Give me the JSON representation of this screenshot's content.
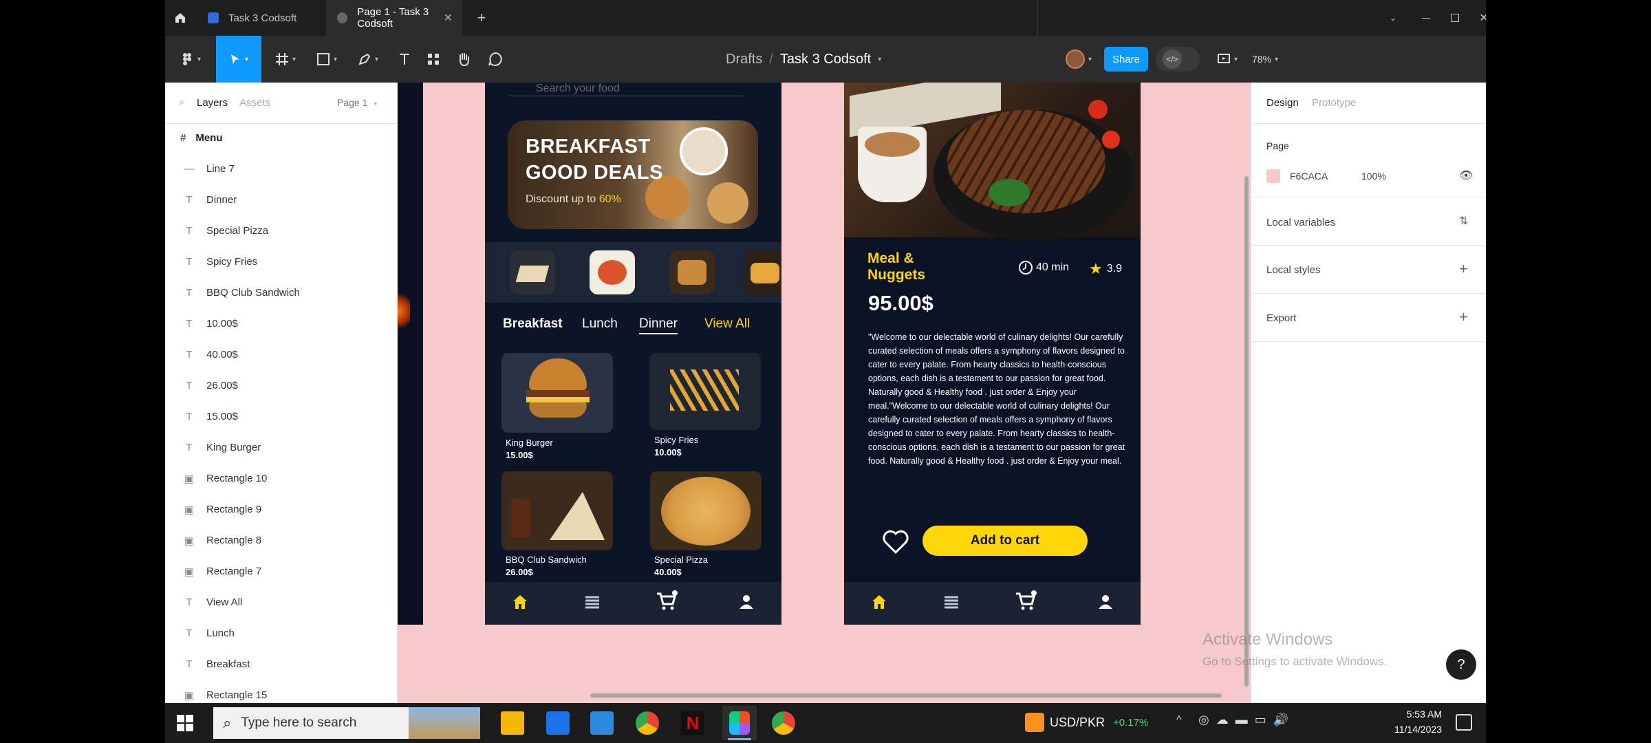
{
  "browser_tabs": [
    {
      "label": "Task 3 Codsoft",
      "active": false
    },
    {
      "label": "Page 1 - Task 3 Codsoft",
      "active": true
    }
  ],
  "breadcrumb": {
    "parent": "Drafts",
    "separator": "/",
    "current": "Task 3 Codsoft"
  },
  "toolbar": {
    "share_label": "Share",
    "zoom": "78%"
  },
  "left_panel": {
    "tabs": [
      "Layers",
      "Assets"
    ],
    "page_selector": "Page 1",
    "root_frame": "Menu",
    "layers": [
      {
        "name": "Line 7",
        "icon": "line"
      },
      {
        "name": "Dinner",
        "icon": "text"
      },
      {
        "name": "Special Pizza",
        "icon": "text"
      },
      {
        "name": "Spicy Fries",
        "icon": "text"
      },
      {
        "name": "BBQ Club Sandwich",
        "icon": "text"
      },
      {
        "name": "10.00$",
        "icon": "text"
      },
      {
        "name": "40.00$",
        "icon": "text"
      },
      {
        "name": "26.00$",
        "icon": "text"
      },
      {
        "name": "15.00$",
        "icon": "text"
      },
      {
        "name": "King Burger",
        "icon": "text"
      },
      {
        "name": "Rectangle 10",
        "icon": "image"
      },
      {
        "name": "Rectangle 9",
        "icon": "image"
      },
      {
        "name": "Rectangle 8",
        "icon": "image"
      },
      {
        "name": "Rectangle 7",
        "icon": "image"
      },
      {
        "name": "View All",
        "icon": "text"
      },
      {
        "name": "Lunch",
        "icon": "text"
      },
      {
        "name": "Breakfast",
        "icon": "text"
      },
      {
        "name": "Rectangle 15",
        "icon": "image"
      }
    ]
  },
  "right_panel": {
    "tabs": [
      "Design",
      "Prototype"
    ],
    "page_heading": "Page",
    "page_color": "F6CACA",
    "page_color_hex": "#f6caca",
    "page_opacity": "100%",
    "sections": [
      "Local variables",
      "Local styles",
      "Export"
    ]
  },
  "menu_screen": {
    "search_placeholder": "Search your food",
    "banner_title_1": "BREAKFAST",
    "banner_title_2": "GOOD DEALS",
    "banner_sub": "Discount up to",
    "banner_discount": "60%",
    "tabs": [
      "Breakfast",
      "Lunch",
      "Dinner"
    ],
    "view_all": "View All",
    "items": [
      {
        "name": "King Burger",
        "price": "15.00$"
      },
      {
        "name": "Spicy Fries",
        "price": "10.00$"
      },
      {
        "name": "BBQ Club Sandwich",
        "price": "26.00$"
      },
      {
        "name": "Special Pizza",
        "price": "40.00$"
      }
    ]
  },
  "detail_screen": {
    "title_1": "Meal &",
    "title_2": "Nuggets",
    "time": "40 min",
    "rating": "3.9",
    "price": "95.00$",
    "description": "\"Welcome to our delectable world of culinary delights! Our carefully curated selection of meals offers a symphony of flavors designed to cater to every palate. From hearty classics to health-conscious options, each dish is a testament to our passion for great food. Naturally good & Healthy food . just order & Enjoy your meal.\"Welcome to our delectable world of culinary delights! Our carefully curated selection of meals offers a symphony of flavors designed to cater to every palate. From hearty classics to health-conscious options, each dish is a testament to our passion for great food. Naturally good & Healthy food . just order & Enjoy your meal.",
    "cta": "Add to cart"
  },
  "watermark": {
    "line1": "Activate Windows",
    "line2": "Go to Settings to activate Windows."
  },
  "taskbar": {
    "search_placeholder": "Type here to search",
    "currency": "USD/PKR",
    "currency_change": "+0.17%",
    "time": "5:53 AM",
    "date": "11/14/2023"
  },
  "colors": {
    "accent": "#0d99ff",
    "brand_yellow": "#ffd60a",
    "app_bg": "#0c1428"
  }
}
